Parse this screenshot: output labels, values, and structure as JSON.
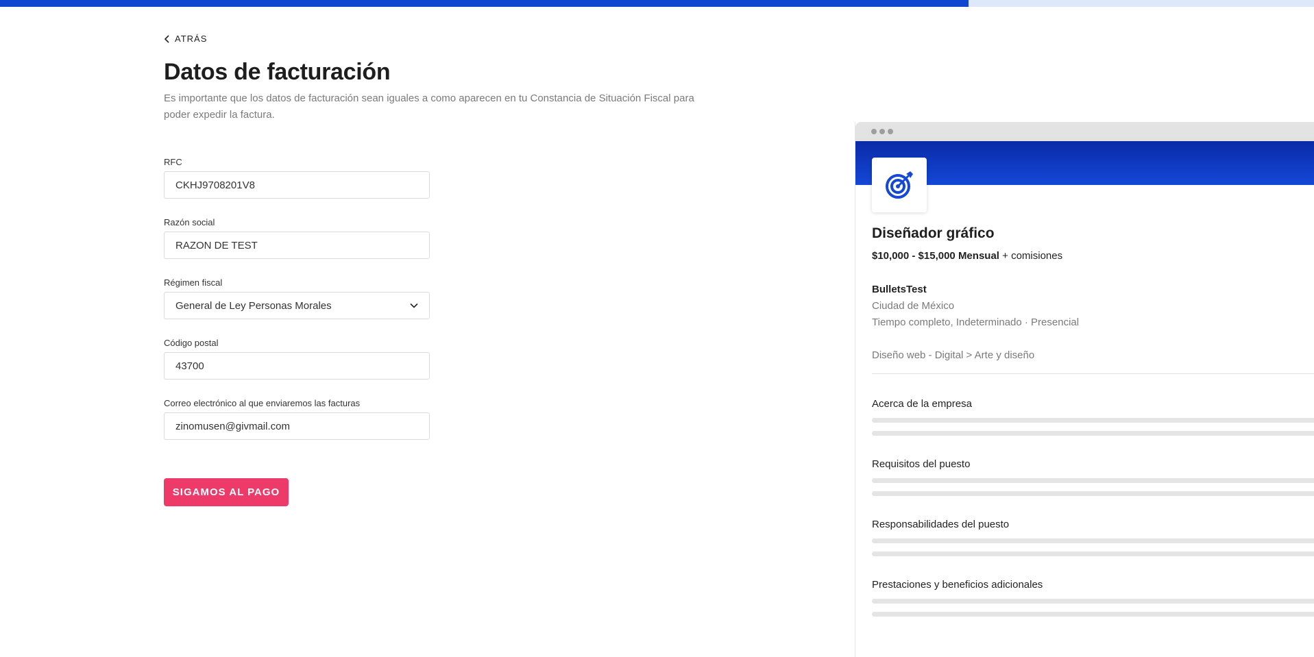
{
  "progress": {
    "percent": 73.7,
    "fill_color": "#1146d0",
    "track_color": "#dde8fb"
  },
  "nav": {
    "back_label": "ATRÁS",
    "back_icon": "chevron-left-icon"
  },
  "page": {
    "title": "Datos de facturación",
    "subtitle": "Es importante que los datos de facturación sean iguales a como aparecen en tu Constancia de Situación Fiscal para poder expedir la factura."
  },
  "form": {
    "rfc": {
      "label": "RFC",
      "value": "CKHJ9708201V8"
    },
    "razon_social": {
      "label": "Razón social",
      "value": "RAZON DE TEST"
    },
    "regimen_fiscal": {
      "label": "Régimen fiscal",
      "value": "General de Ley Personas Morales",
      "icon": "chevron-down-icon"
    },
    "codigo_postal": {
      "label": "Código postal",
      "value": "43700"
    },
    "correo": {
      "label": "Correo electrónico al que enviaremos las facturas",
      "value": "zinomusen@givmail.com"
    },
    "submit_label": "SIGAMOS AL PAGO",
    "submit_color": "#ee3a69"
  },
  "preview": {
    "logo_icon": "target-icon",
    "accent_color": "#1448d6",
    "job_title": "Diseñador gráfico",
    "salary_range": "$10,000 - $15,000 Mensual",
    "salary_extra": " + comisiones",
    "company": "BulletsTest",
    "location": "Ciudad de México",
    "schedule": "Tiempo completo, Indeterminado · Presencial",
    "category": "Diseño web - Digital > Arte y diseño",
    "sections": [
      {
        "title": "Acerca de la empresa"
      },
      {
        "title": "Requisitos del puesto"
      },
      {
        "title": "Responsabilidades del puesto"
      },
      {
        "title": "Prestaciones y beneficios adicionales"
      }
    ]
  }
}
